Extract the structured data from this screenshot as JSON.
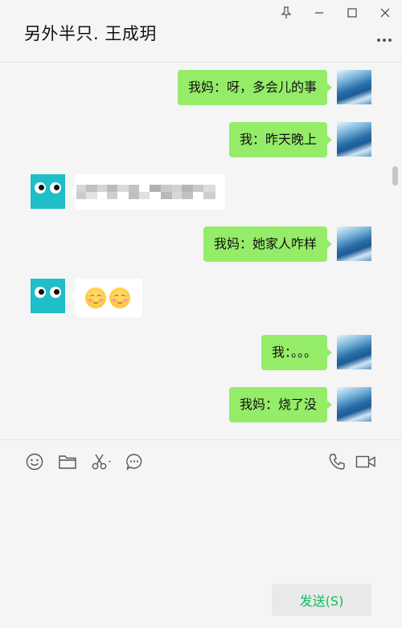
{
  "header": {
    "title": "另外半只. 王成玥",
    "icons": [
      "pin-icon",
      "minimize-icon",
      "maximize-icon",
      "close-icon",
      "more-icon"
    ]
  },
  "messages": [
    {
      "side": "self",
      "text": "我妈：呀，多会儿的事"
    },
    {
      "side": "self",
      "text": "我：昨天晚上"
    },
    {
      "side": "peer",
      "type": "pixelated-text"
    },
    {
      "side": "self",
      "text": "我妈：她家人咋样"
    },
    {
      "side": "peer",
      "type": "emoji",
      "emoji_count": 2,
      "emoji_icon": "smiling-face-icon"
    },
    {
      "side": "self",
      "text": "我：。。。"
    },
    {
      "side": "self",
      "text": "我妈：烧了没"
    }
  ],
  "toolbar": {
    "icons": [
      "emoji-icon",
      "folder-icon",
      "scissors-icon",
      "chat-history-icon",
      "voice-call-icon",
      "video-call-icon"
    ]
  },
  "input": {
    "value": ""
  },
  "send_button": {
    "label": "发送(S)"
  },
  "colors": {
    "self_bubble": "#95ec69",
    "peer_bubble": "#ffffff",
    "peer_avatar": "#1fbec8",
    "send_text": "#07c160",
    "background": "#f5f5f5"
  }
}
